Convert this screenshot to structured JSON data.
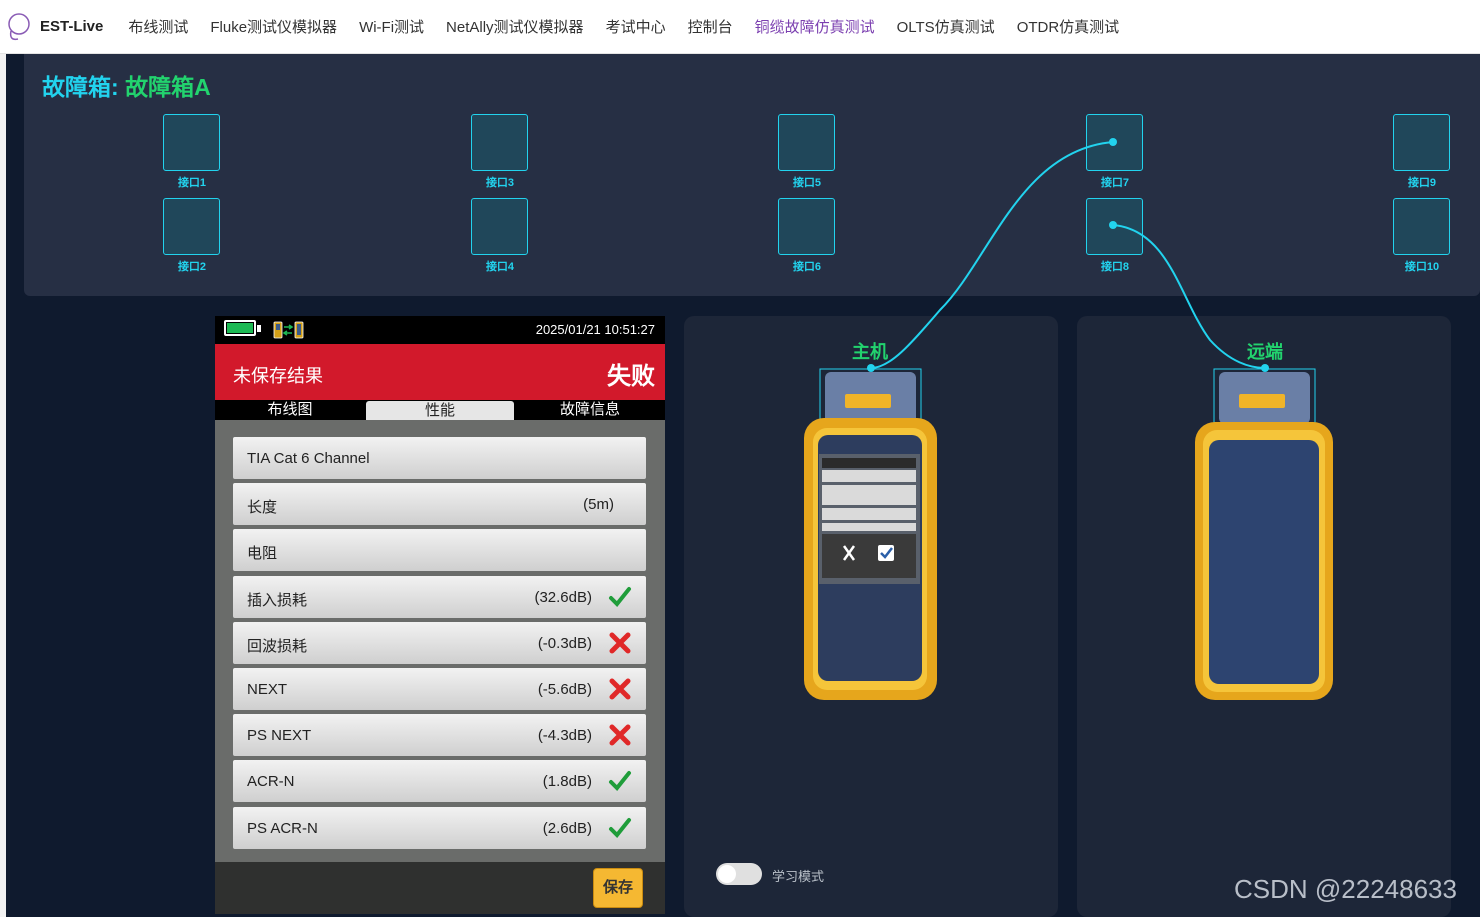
{
  "app": {
    "logo_text": "EST-Live"
  },
  "nav": [
    {
      "label": "布线测试",
      "active": false
    },
    {
      "label": "Fluke测试仪模拟器",
      "active": false
    },
    {
      "label": "Wi-Fi测试",
      "active": false
    },
    {
      "label": "NetAlly测试仪模拟器",
      "active": false
    },
    {
      "label": "考试中心",
      "active": false
    },
    {
      "label": "控制台",
      "active": false
    },
    {
      "label": "铜缆故障仿真测试",
      "active": true
    },
    {
      "label": "OLTS仿真测试",
      "active": false
    },
    {
      "label": "OTDR仿真测试",
      "active": false
    }
  ],
  "faultbox": {
    "title_prefix": "故障箱:",
    "title_name": "故障箱A",
    "ports": [
      "接口1",
      "接口2",
      "接口3",
      "接口4",
      "接口5",
      "接口6",
      "接口7",
      "接口8",
      "接口9",
      "接口10"
    ]
  },
  "tester": {
    "timestamp": "2025/01/21 10:51:27",
    "result_text": "未保存结果",
    "result_status": "失败",
    "tabs": [
      "布线图",
      "性能",
      "故障信息"
    ],
    "active_tab": "性能",
    "rows": [
      {
        "label": "TIA Cat 6 Channel",
        "value": "",
        "status": "none"
      },
      {
        "label": "长度",
        "value": "(5m)",
        "status": "none"
      },
      {
        "label": "电阻",
        "value": "",
        "status": "none"
      },
      {
        "label": "插入损耗",
        "value": "(32.6dB)",
        "status": "pass"
      },
      {
        "label": "回波损耗",
        "value": "(-0.3dB)",
        "status": "fail"
      },
      {
        "label": "NEXT",
        "value": "(-5.6dB)",
        "status": "fail"
      },
      {
        "label": "PS NEXT",
        "value": "(-4.3dB)",
        "status": "fail"
      },
      {
        "label": "ACR-N",
        "value": "(1.8dB)",
        "status": "pass"
      },
      {
        "label": "PS ACR-N",
        "value": "(2.6dB)",
        "status": "pass"
      }
    ],
    "save_label": "保存"
  },
  "main_unit": {
    "label": "主机"
  },
  "remote_unit": {
    "label": "远端"
  },
  "learning_mode": {
    "label": "学习模式",
    "enabled": false
  },
  "watermark": "CSDN @22248633",
  "colors": {
    "accent_cyan": "#22d3ee",
    "accent_green": "#22d36e",
    "fail_red": "#d2192b",
    "pass_green": "#1f9d3a",
    "nav_active": "#7b3fb0"
  }
}
